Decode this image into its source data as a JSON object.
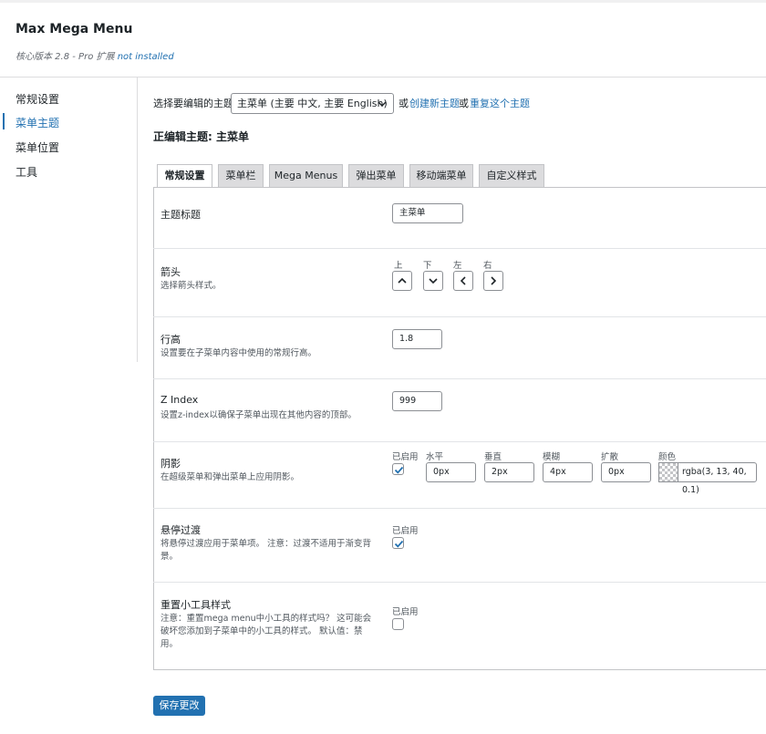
{
  "app": {
    "title": "Max Mega Menu",
    "version_prefix": "核心版本 2.8 - Pro 扩展",
    "pro_status": "not installed"
  },
  "sidebar": {
    "items": [
      {
        "label": "常规设置",
        "active": false
      },
      {
        "label": "菜单主题",
        "active": true
      },
      {
        "label": "菜单位置",
        "active": false
      },
      {
        "label": "工具",
        "active": false
      }
    ]
  },
  "theme_bar": {
    "select_label": "选择要编辑的主题",
    "selected": "主菜单 (主要 中文, 主要 English)",
    "or1": "或",
    "create_link": "创建新主题",
    "or2": "或",
    "duplicate_link": "重复这个主题"
  },
  "editing": "正编辑主题: 主菜单",
  "tabs": [
    {
      "label": "常规设置",
      "active": true
    },
    {
      "label": "菜单栏",
      "active": false
    },
    {
      "label": "Mega Menus",
      "active": false
    },
    {
      "label": "弹出菜单",
      "active": false
    },
    {
      "label": "移动端菜单",
      "active": false
    },
    {
      "label": "自定义样式",
      "active": false
    }
  ],
  "settings": {
    "title": {
      "label": "主题标题",
      "value": "主菜单"
    },
    "arrows": {
      "label": "箭头",
      "desc": "选择箭头样式。",
      "up": "上",
      "down": "下",
      "left": "左",
      "right": "右"
    },
    "line_height": {
      "label": "行高",
      "desc": "设置要在子菜单内容中使用的常规行高。",
      "value": "1.8"
    },
    "z_index": {
      "label": "Z Index",
      "desc": "设置z-index以确保子菜单出现在其他内容的顶部。",
      "value": "999"
    },
    "shadow": {
      "label": "阴影",
      "desc": "在超级菜单和弹出菜单上应用阴影。",
      "enabled_label": "已启用",
      "enabled": true,
      "horizontal_label": "水平",
      "horizontal": "0px",
      "vertical_label": "垂直",
      "vertical": "2px",
      "blur_label": "模糊",
      "blur": "4px",
      "spread_label": "扩散",
      "spread": "0px",
      "color_label": "颜色",
      "color": "rgba(3, 13, 40, 0.1)"
    },
    "hover_transition": {
      "label": "悬停过渡",
      "desc": "将悬停过渡应用于菜单项。 注意：过渡不适用于渐变背景。",
      "enabled_label": "已启用",
      "enabled": true
    },
    "reset_widgets": {
      "label": "重置小工具样式",
      "desc": "注意：重置mega menu中小工具的样式吗？ 这可能会破坏您添加到子菜单中的小工具的样式。 默认值：禁用。",
      "enabled_label": "已启用",
      "enabled": false
    }
  },
  "save_button": "保存更改",
  "colors": {
    "accent": "#2271b1",
    "border": "#c3c4c7",
    "tab_bg": "#dcdcde"
  }
}
